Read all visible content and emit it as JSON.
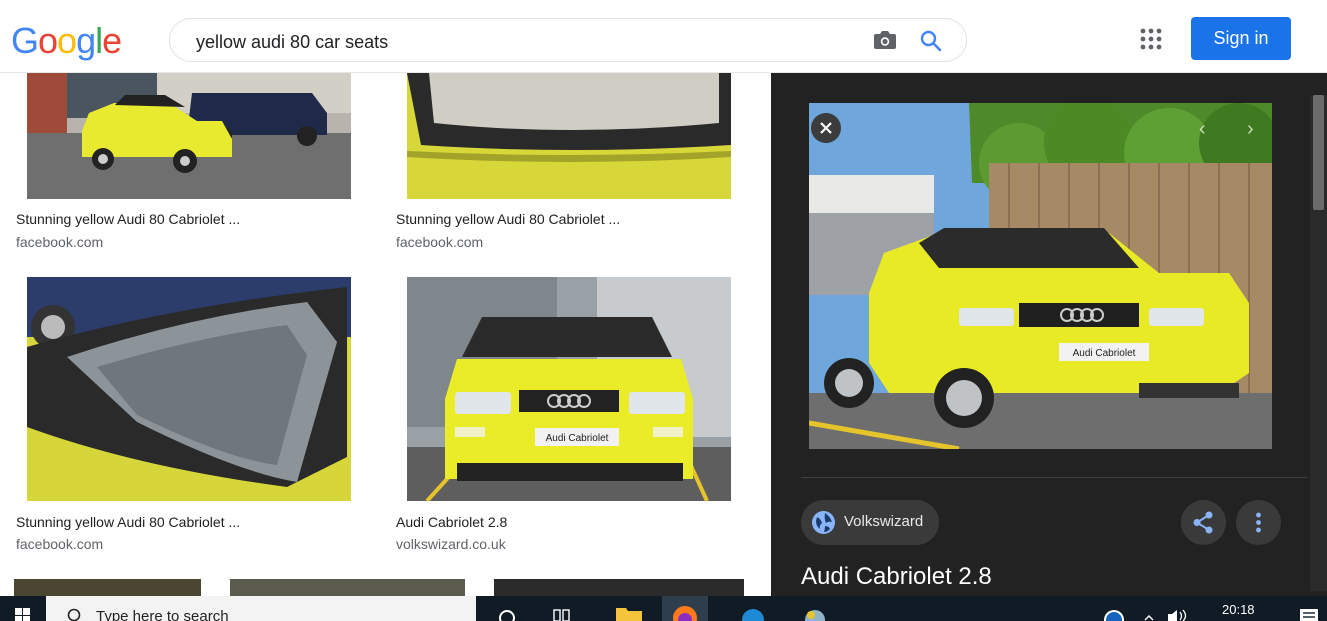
{
  "header": {
    "logo_letters": [
      "G",
      "o",
      "o",
      "g",
      "l",
      "e"
    ],
    "search_query": "yellow audi 80 car seats",
    "sign_in_label": "Sign in",
    "colors": {
      "blue": "#4285F4",
      "red": "#EA4335",
      "yellow": "#FBBC05",
      "green": "#34A853",
      "accent": "#1a73e8"
    }
  },
  "results": [
    {
      "title": "Stunning yellow Audi 80 Cabriolet ...",
      "source": "facebook.com"
    },
    {
      "title": "Stunning yellow Audi 80 Cabriolet ...",
      "source": "facebook.com"
    },
    {
      "title": "Stunning yellow Audi 80 Cabriolet ...",
      "source": "facebook.com"
    },
    {
      "title": "Audi Cabriolet 2.8",
      "source": "volkswizard.co.uk"
    }
  ],
  "panel": {
    "plate_text": "Audi Cabriolet",
    "source_name": "Volkswizard",
    "title": "Audi Cabriolet 2.8"
  },
  "taskbar": {
    "search_placeholder": "Type here to search",
    "clock": "20:18"
  }
}
